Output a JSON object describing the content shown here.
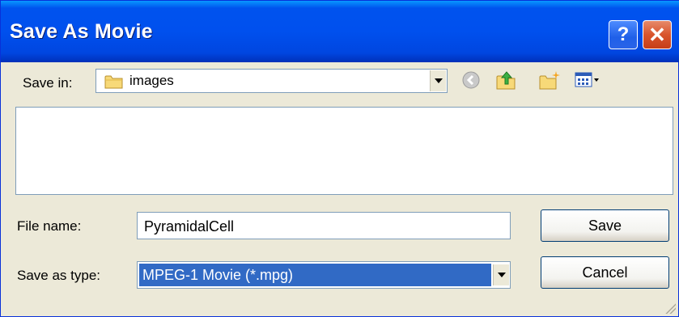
{
  "window": {
    "title": "Save As Movie",
    "help_glyph": "?",
    "close_glyph": "✕"
  },
  "save_in": {
    "label": "Save in:",
    "value": "images"
  },
  "toolbar": {
    "icons": [
      "back-icon",
      "up-folder-icon",
      "new-folder-icon",
      "view-menu-icon"
    ]
  },
  "file_list": {
    "items": []
  },
  "file_name": {
    "label": "File name:",
    "value": "PyramidalCell"
  },
  "save_as_type": {
    "label": "Save as type:",
    "value": "MPEG-1 Movie (*.mpg)"
  },
  "buttons": {
    "save": "Save",
    "cancel": "Cancel"
  },
  "colors": {
    "titlebar": "#0053ee",
    "dialog_bg": "#ece9d8",
    "selection": "#316ac5"
  }
}
